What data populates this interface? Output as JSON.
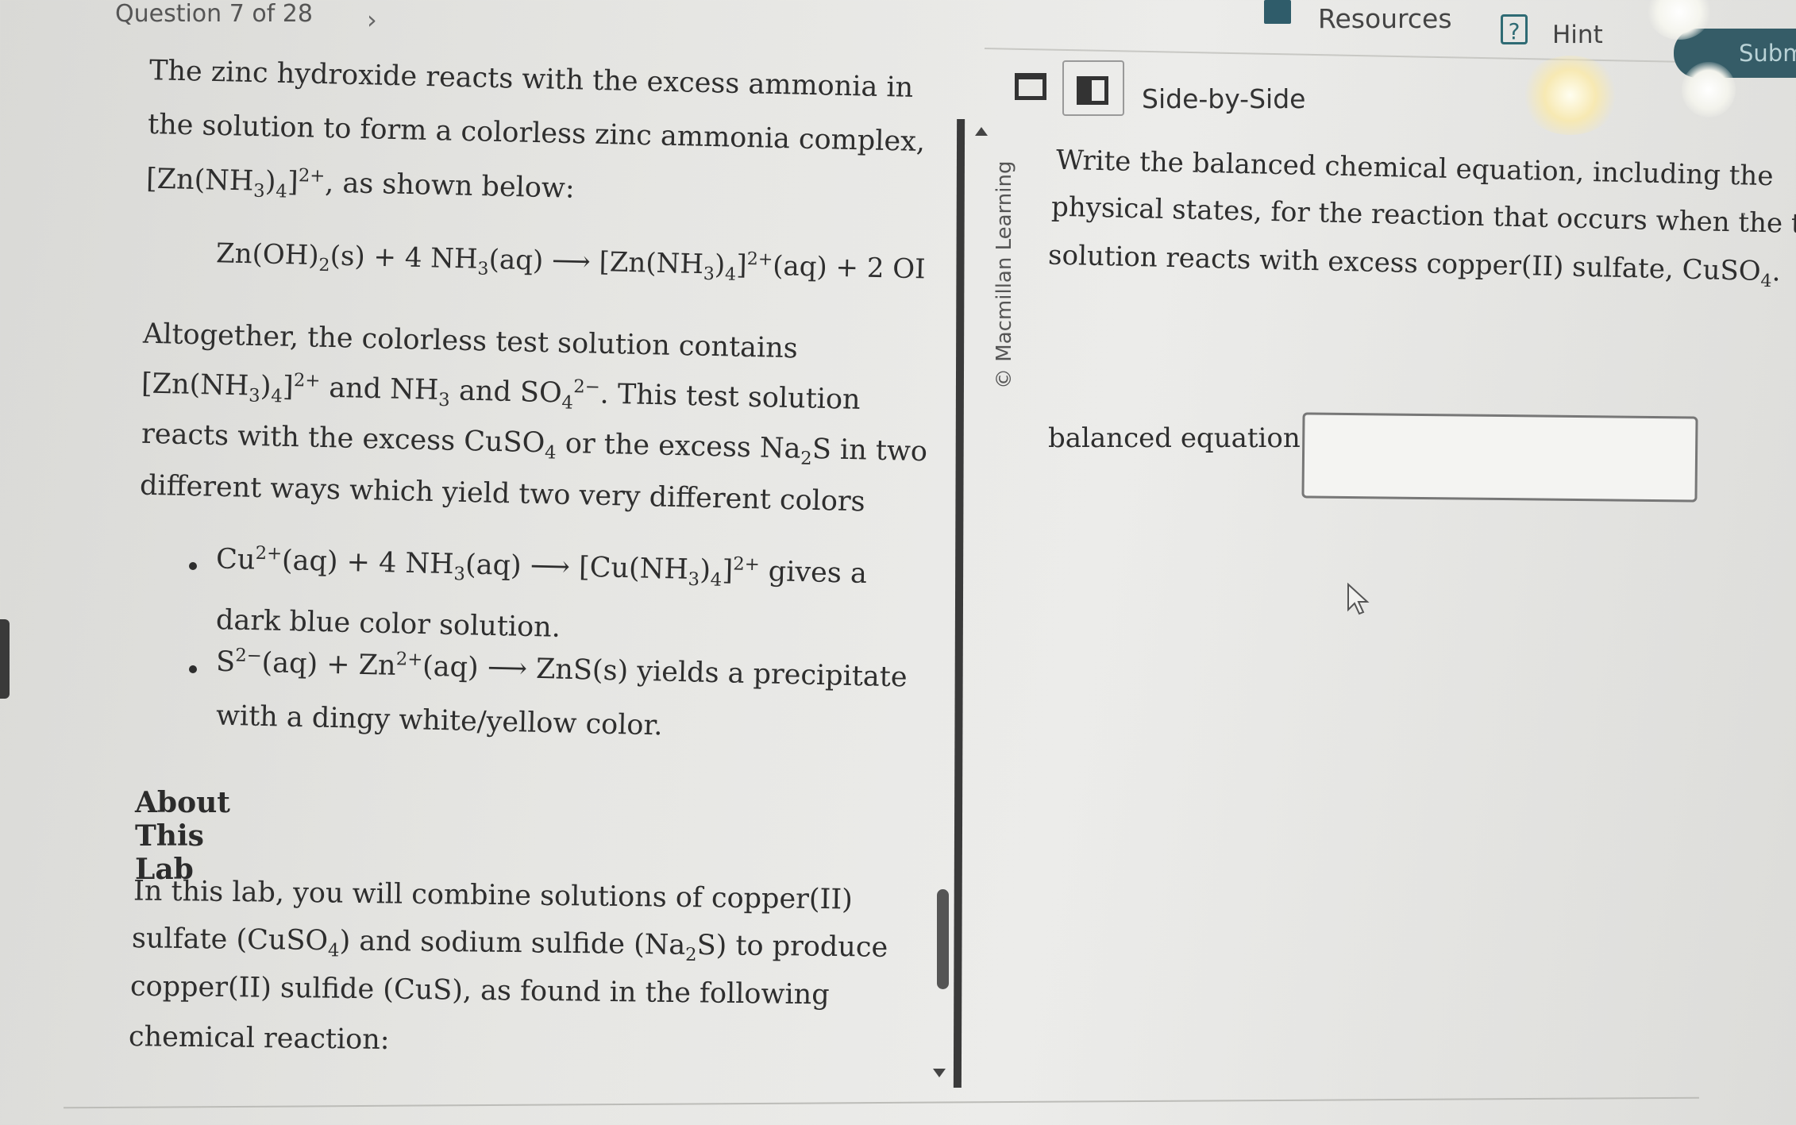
{
  "header": {
    "question_nav": "Question 7 of 28",
    "next_glyph": "›",
    "resources_label": "Resources",
    "hint_glyph": "?",
    "hint_label": "Hint",
    "submit_label": "Subm"
  },
  "view_toggle": {
    "label": "Side-by-Side"
  },
  "passage": {
    "p1_line1": "The zinc hydroxide reacts with the excess ammonia in",
    "p1_line2": "the solution to form a colorless zinc ammonia complex,",
    "p1_line3_tail": ", as shown below:",
    "equation1_left": "Zn(OH)",
    "equation1_mid": "(s) + 4 NH",
    "equation1_right": "(aq) ⟶ [Zn(NH",
    "equation1_end": "(aq) + 2 OI",
    "p2_line1": "Altogether, the colorless test solution contains",
    "p2_line2_and": "and NH",
    "p2_line2_and2": "and SO",
    "p2_line2_tail": ". This test solution",
    "p2_line3_a": "reacts with the excess CuSO",
    "p2_line3_b": "or the excess Na",
    "p2_line3_c": "S in two",
    "p2_line4": "different ways which yield two very different colors",
    "bullet1_a": "Cu",
    "bullet1_b": "(aq) + 4 NH",
    "bullet1_c": "(aq) ⟶ [Cu(NH",
    "bullet1_d": "gives a",
    "bullet1_line2": "dark blue color solution.",
    "bullet2_a": "S",
    "bullet2_b": "(aq) + Zn",
    "bullet2_c": "(aq) ⟶ ZnS(s) yields a precipitate",
    "bullet2_line2": "with a dingy white/yellow color.",
    "about_heading": "About This Lab",
    "about_line1": "In this lab, you will combine solutions of copper(II)",
    "about_line2_a": "sulfate (CuSO",
    "about_line2_b": ") and sodium sulfide (Na",
    "about_line2_c": "S) to produce",
    "about_line3": "copper(II) sulfide (CuS), as found in the following",
    "about_line4": "chemical reaction:"
  },
  "prompt": {
    "line1": "Write the balanced chemical equation, including the",
    "line2": "physical states, for the reaction that occurs when the test",
    "line3_a": "solution reacts with excess copper(II) sulfate, CuSO",
    "line3_b": ".",
    "answer_label": "balanced equation:",
    "answer_value": ""
  },
  "copyright": "© Macmillan Learning",
  "colors": {
    "accent_teal": "#2f6b74",
    "submit_bg": "#355c67"
  },
  "icons": {
    "resources": "book-icon",
    "hint": "question-box-icon",
    "view_single": "single-panel-icon",
    "view_sbs": "side-by-side-icon",
    "cursor": "mouse-pointer-icon"
  }
}
